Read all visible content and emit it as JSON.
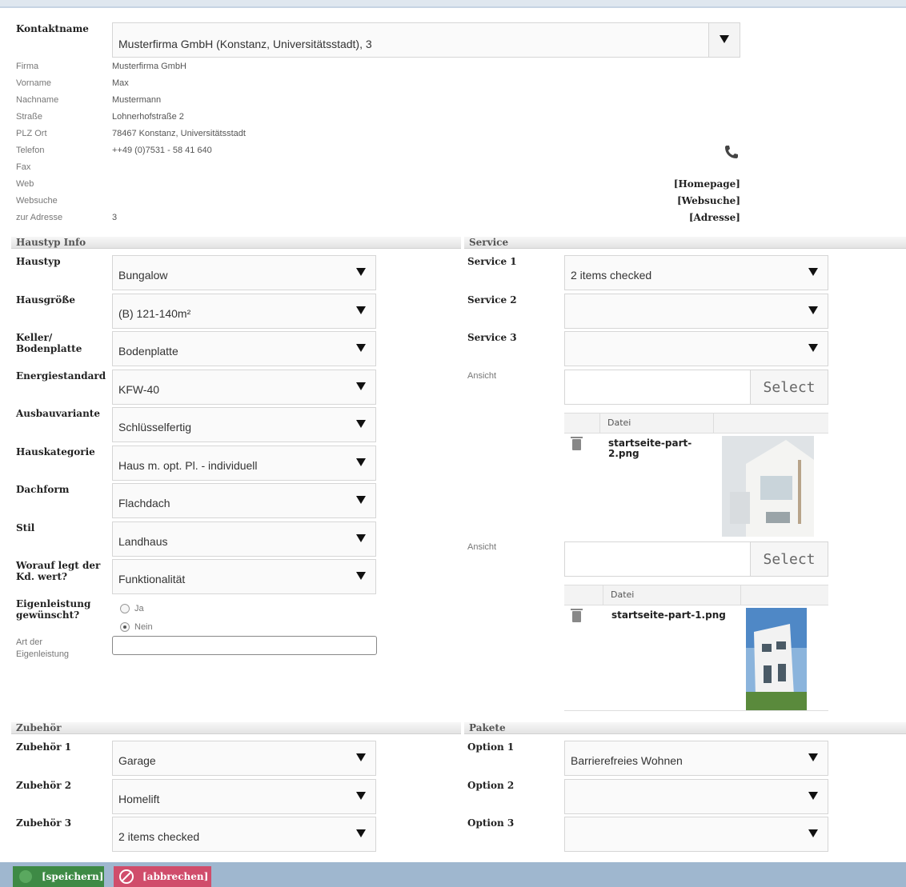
{
  "contact": {
    "label": "Kontaktname",
    "selected": "Musterfirma GmbH (Konstanz, Universitätsstadt), 3",
    "fields": [
      {
        "label": "Firma",
        "value": "Musterfirma GmbH"
      },
      {
        "label": "Vorname",
        "value": "Max"
      },
      {
        "label": "Nachname",
        "value": "Mustermann"
      },
      {
        "label": "Straße",
        "value": "Lohnerhofstraße 2"
      },
      {
        "label": "PLZ Ort",
        "value": "78467 Konstanz, Universitätsstadt"
      },
      {
        "label": "Telefon",
        "value": "++49 (0)7531 - 58 41 640"
      },
      {
        "label": "Fax",
        "value": ""
      },
      {
        "label": "Web",
        "value": ""
      },
      {
        "label": "Websuche",
        "value": ""
      },
      {
        "label": "zur Adresse",
        "value": "3"
      }
    ],
    "links": {
      "homepage": "[Homepage]",
      "websuche": "[Websuche]",
      "adresse": "[Adresse]"
    }
  },
  "haustyp": {
    "title": "Haustyp Info",
    "rows": [
      {
        "label": "Haustyp",
        "value": "Bungalow"
      },
      {
        "label": "Hausgröße",
        "value": "(B) 121-140m²"
      },
      {
        "label": "Keller/ Bodenplatte",
        "value": "Bodenplatte"
      },
      {
        "label": "Energiestandard",
        "value": "KFW-40"
      },
      {
        "label": "Ausbauvariante",
        "value": "Schlüsselfertig"
      },
      {
        "label": "Hauskategorie",
        "value": "Haus m. opt. Pl. - individuell"
      },
      {
        "label": "Dachform",
        "value": "Flachdach"
      },
      {
        "label": "Stil",
        "value": "Landhaus"
      },
      {
        "label": "Worauf legt der Kd. wert?",
        "value": "Funktionalität"
      }
    ],
    "eigenleistung": {
      "label": "Eigenleistung gewünscht?",
      "option_yes": "Ja",
      "option_no": "Nein"
    },
    "art_label": "Art der Eigenleistung"
  },
  "service": {
    "title": "Service",
    "rows": [
      {
        "label": "Service 1",
        "value": "2 items checked"
      },
      {
        "label": "Service 2",
        "value": ""
      },
      {
        "label": "Service 3",
        "value": ""
      }
    ],
    "ansicht_label": "Ansicht",
    "select_label": "Select",
    "datei_header": "Datei",
    "file1": "startseite-part-2.png",
    "file2": "startseite-part-1.png"
  },
  "zubehoer": {
    "title": "Zubehör",
    "rows": [
      {
        "label": "Zubehör 1",
        "value": "Garage"
      },
      {
        "label": "Zubehör 2",
        "value": "Homelift"
      },
      {
        "label": "Zubehör 3",
        "value": "2 items checked"
      }
    ]
  },
  "pakete": {
    "title": "Pakete",
    "rows": [
      {
        "label": "Option 1",
        "value": "Barrierefreies Wohnen"
      },
      {
        "label": "Option 2",
        "value": ""
      },
      {
        "label": "Option 3",
        "value": ""
      }
    ]
  },
  "footer": {
    "save_label": "[speichern]",
    "cancel_label": "[abbrechen]"
  }
}
